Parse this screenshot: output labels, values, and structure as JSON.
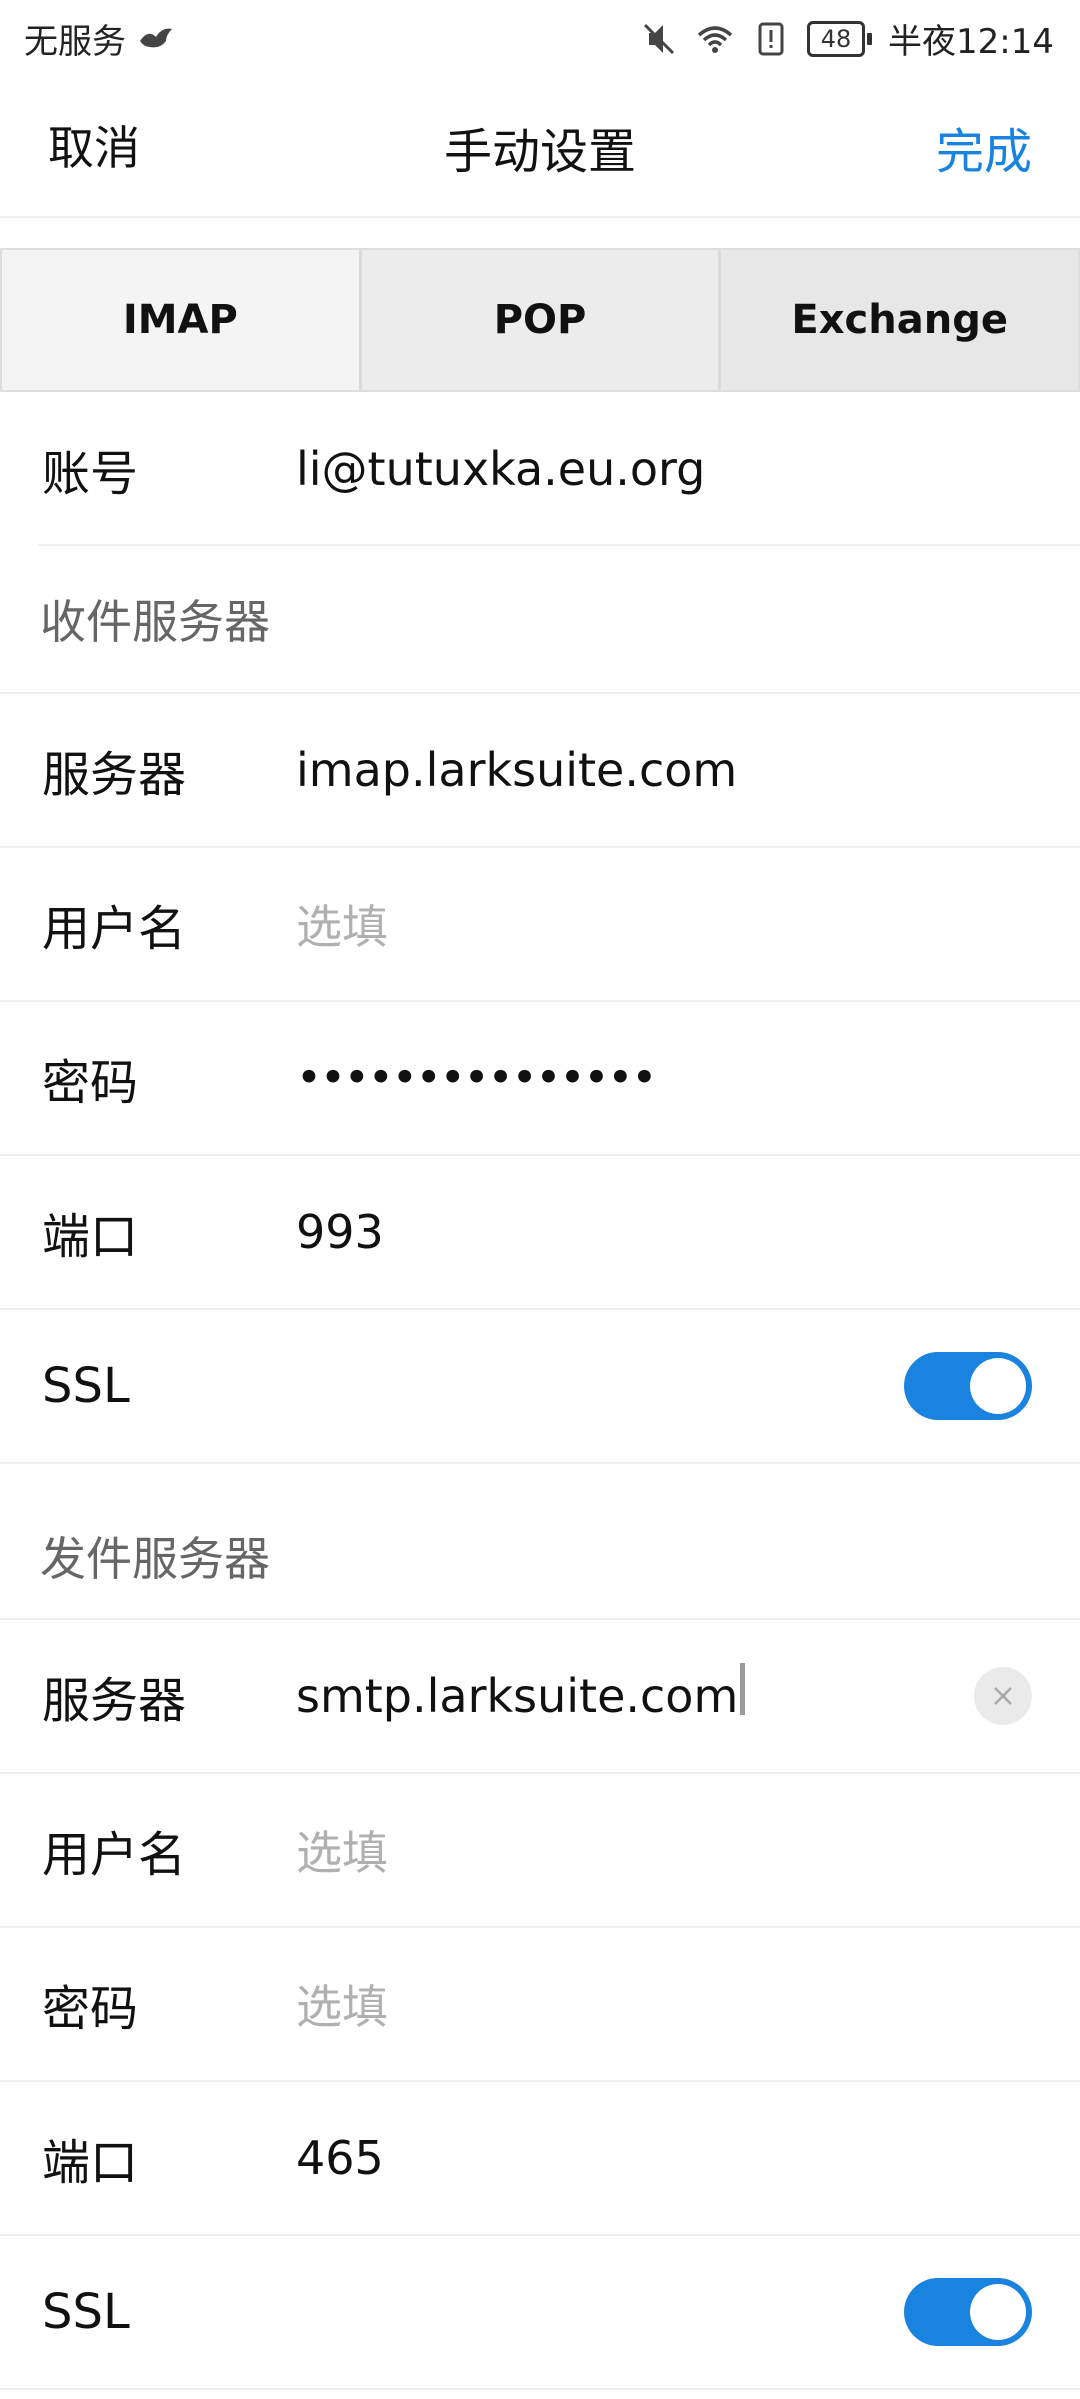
{
  "status_bar": {
    "carrier": "无服务",
    "time": "半夜12:14",
    "battery": "48"
  },
  "nav": {
    "cancel": "取消",
    "title": "手动设置",
    "done": "完成"
  },
  "tabs": [
    "IMAP",
    "POP",
    "Exchange"
  ],
  "account": {
    "label": "账号",
    "value": "li@tutuxka.eu.org"
  },
  "incoming": {
    "title": "收件服务器",
    "server_label": "服务器",
    "server_value": "imap.larksuite.com",
    "username_label": "用户名",
    "username_placeholder": "选填",
    "password_label": "密码",
    "password_value": "•••••••••••••••",
    "port_label": "端口",
    "port_value": "993",
    "ssl_label": "SSL",
    "ssl_enabled": true
  },
  "outgoing": {
    "title": "发件服务器",
    "server_label": "服务器",
    "server_value": "smtp.larksuite.com",
    "username_label": "用户名",
    "username_placeholder": "选填",
    "password_label": "密码",
    "password_placeholder": "选填",
    "port_label": "端口",
    "port_value": "465",
    "ssl_label": "SSL",
    "ssl_enabled": true
  },
  "colors": {
    "accent": "#1a83e0",
    "placeholder": "#b0b0b0",
    "section_title": "#666666"
  }
}
